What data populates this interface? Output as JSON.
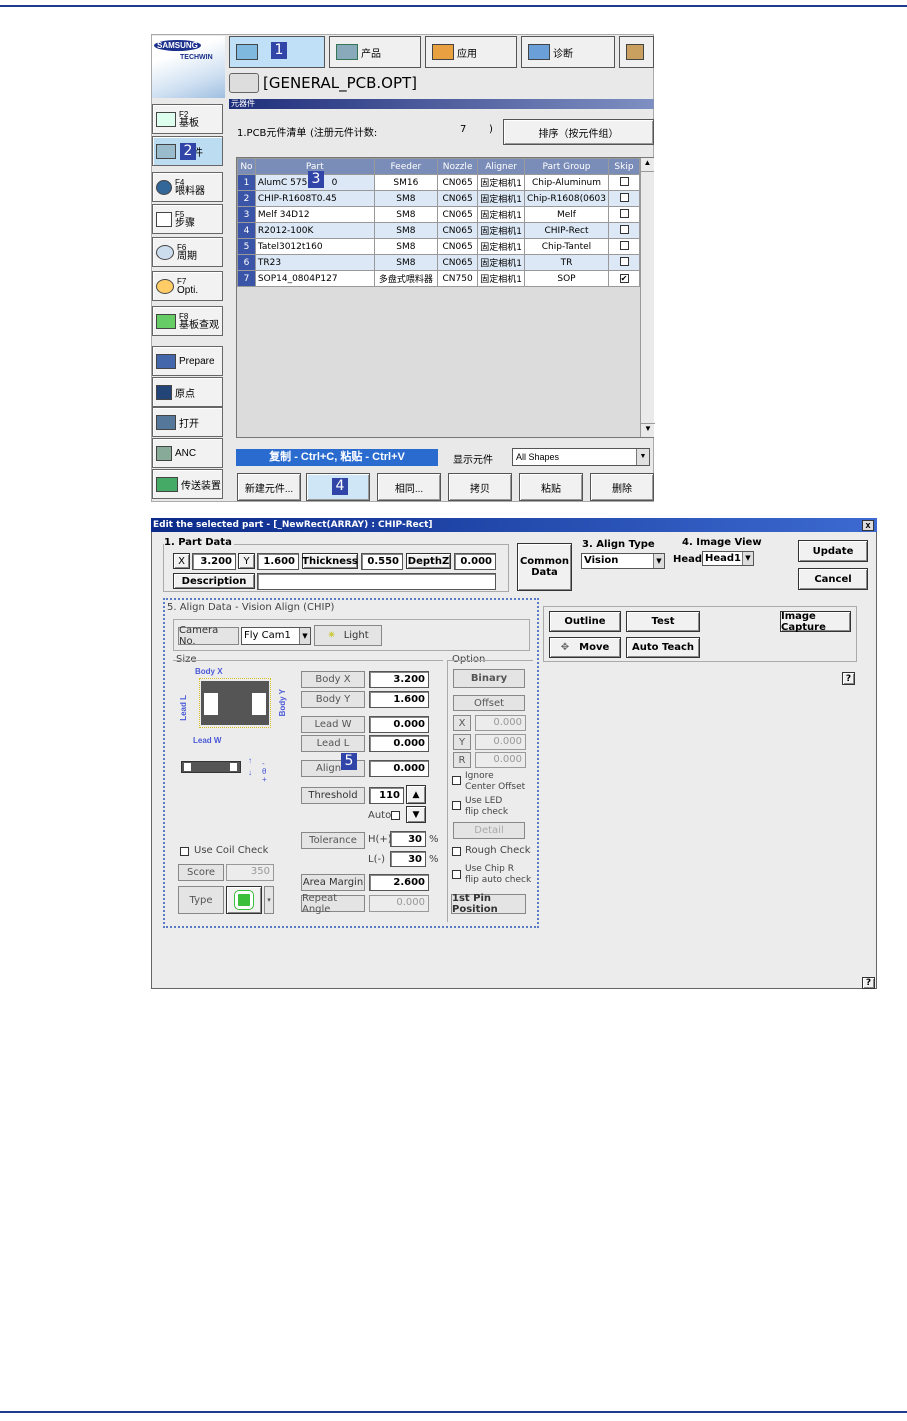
{
  "top_app": {
    "logo_line1": "SAMSUNG",
    "logo_line2": "TECHWIN",
    "tabs": [
      {
        "label": "",
        "badge": "1"
      },
      {
        "label": "产品"
      },
      {
        "label": "应用"
      },
      {
        "label": "诊断"
      }
    ],
    "file_name": "[GENERAL_PCB.OPT]",
    "section_title": "元器件",
    "sidebar": [
      {
        "key": "F2",
        "label": "基板"
      },
      {
        "key": "",
        "label": "件",
        "badge": "2"
      },
      {
        "key": "F4",
        "label": "喂料器"
      },
      {
        "key": "F5",
        "label": "步骤"
      },
      {
        "key": "F6",
        "label": "周期"
      },
      {
        "key": "F7",
        "label": "Opti."
      },
      {
        "key": "F8",
        "label": "基板查观"
      },
      {
        "key": "",
        "label": "Prepare"
      },
      {
        "key": "",
        "label": "原点"
      },
      {
        "key": "",
        "label": "打开"
      },
      {
        "key": "",
        "label": "ANC"
      },
      {
        "key": "",
        "label": "传送装置"
      }
    ],
    "list_title": "1.PCB元件清单",
    "count_label": "(注册元件计数:",
    "count_value": "7",
    "count_close": ")",
    "sort_button": "排序（按元件组）",
    "columns": [
      "No",
      "Part",
      "Feeder",
      "Nozzle",
      "Aligner",
      "Part Group",
      "Skip"
    ],
    "rows": [
      {
        "no": "1",
        "part": "AlumC 5753_",
        "part_tail": "0",
        "feeder": "SM16",
        "nozzle": "CN065",
        "aligner": "固定相机1",
        "group": "Chip-Aluminum",
        "skip": ""
      },
      {
        "no": "2",
        "part": "CHIP-R1608T0.45",
        "part_tail": "",
        "feeder": "SM8",
        "nozzle": "CN065",
        "aligner": "固定相机1",
        "group": "Chip-R1608(0603",
        "skip": ""
      },
      {
        "no": "3",
        "part": "Melf 34D12",
        "part_tail": "",
        "feeder": "SM8",
        "nozzle": "CN065",
        "aligner": "固定相机1",
        "group": "Melf",
        "skip": ""
      },
      {
        "no": "4",
        "part": "R2012-100K",
        "part_tail": "",
        "feeder": "SM8",
        "nozzle": "CN065",
        "aligner": "固定相机1",
        "group": "CHIP-Rect",
        "skip": ""
      },
      {
        "no": "5",
        "part": "Tatel3012t160",
        "part_tail": "",
        "feeder": "SM8",
        "nozzle": "CN065",
        "aligner": "固定相机1",
        "group": "Chip-Tantel",
        "skip": ""
      },
      {
        "no": "6",
        "part": "TR23",
        "part_tail": "",
        "feeder": "SM8",
        "nozzle": "CN065",
        "aligner": "固定相机1",
        "group": "TR",
        "skip": ""
      },
      {
        "no": "7",
        "part": "SOP14_0804P127",
        "part_tail": "",
        "feeder": "多盘式喂料器",
        "nozzle": "CN750",
        "aligner": "固定相机1",
        "group": "SOP",
        "skip": "✔"
      }
    ],
    "badge3": "3",
    "copy_hint": "复制 - Ctrl+C, 粘贴 - Ctrl+V",
    "show_label": "显示元件",
    "show_value": "All Shapes",
    "bottom_buttons": [
      "新建元件...",
      "编",
      "相同...",
      "拷贝",
      "粘贴",
      "删除"
    ],
    "badge4": "4"
  },
  "dialog": {
    "title": "Edit the selected part - [_NewRect(ARRAY) : CHIP-Rect]",
    "close": "x",
    "part_data_label": "1. Part Data",
    "x_label": "X",
    "x_value": "3.200",
    "y_label": "Y",
    "y_value": "1.600",
    "thickness_label": "Thickness",
    "thickness_value": "0.550",
    "depthz_label": "DepthZ",
    "depthz_value": "0.000",
    "description_label": "Description",
    "common_data": [
      "Common",
      "Data"
    ],
    "align_type_label": "3. Align Type",
    "align_type_value": "Vision",
    "image_view_label": "4. Image View",
    "head_label": "Head",
    "head_value": "Head1",
    "update": "Update",
    "cancel": "Cancel",
    "outline": "Outline",
    "test": "Test",
    "image_capture": "Image Capture",
    "move": "Move",
    "auto_teach": "Auto Teach",
    "help": "?",
    "align_data_label": "5. Align Data - Vision Align (CHIP)",
    "camera_label": "Camera No.",
    "camera_value": "Fly Cam1",
    "light": "Light",
    "size_label": "Size",
    "body_x_diag": "Body X",
    "body_y_diag": "Body Y",
    "lead_l_diag": "Lead L",
    "lead_w_diag": "Lead W",
    "fields": {
      "body_x": {
        "label": "Body X",
        "value": "3.200"
      },
      "body_y": {
        "label": "Body Y",
        "value": "1.600"
      },
      "lead_w": {
        "label": "Lead W",
        "value": "0.000"
      },
      "lead_l": {
        "label": "Lead L",
        "value": "0.000"
      },
      "align": {
        "label": "Align",
        "value": "0.000"
      },
      "threshold": {
        "label": "Threshold",
        "value": "110"
      },
      "tolerance": {
        "label": "Tolerance"
      },
      "h_plus": {
        "label": "H(+)",
        "value": "30",
        "unit": "%"
      },
      "l_minus": {
        "label": "L(-)",
        "value": "30",
        "unit": "%"
      },
      "area_margin": {
        "label": "Area Margin",
        "value": "2.600"
      },
      "repeat_angle": {
        "label": "Repeat Angle",
        "value": "0.000"
      }
    },
    "auto_label": "Auto",
    "badge5": "5",
    "use_coil_check": "Use Coil Check",
    "score_label": "Score",
    "score_value": "350",
    "type_label": "Type",
    "option_label": "Option",
    "binary": "Binary",
    "offset": "Offset",
    "offset_x": "X",
    "offset_x_value": "0.000",
    "offset_y": "Y",
    "offset_y_value": "0.000",
    "offset_r": "R",
    "offset_r_value": "0.000",
    "ignore_center": [
      "Ignore",
      "Center Offset"
    ],
    "use_led": [
      "Use LED",
      "flip check"
    ],
    "detail": "Detail",
    "rough_check": "Rough Check",
    "use_chip_r": [
      "Use Chip R",
      "flip auto check"
    ],
    "first_pin": "1st Pin Position"
  },
  "colors": {
    "rule": "#1f3a8c",
    "header_blue": "#1f3a8c",
    "badge": "#3144a8",
    "copy_bar": "#2a6bd0"
  }
}
